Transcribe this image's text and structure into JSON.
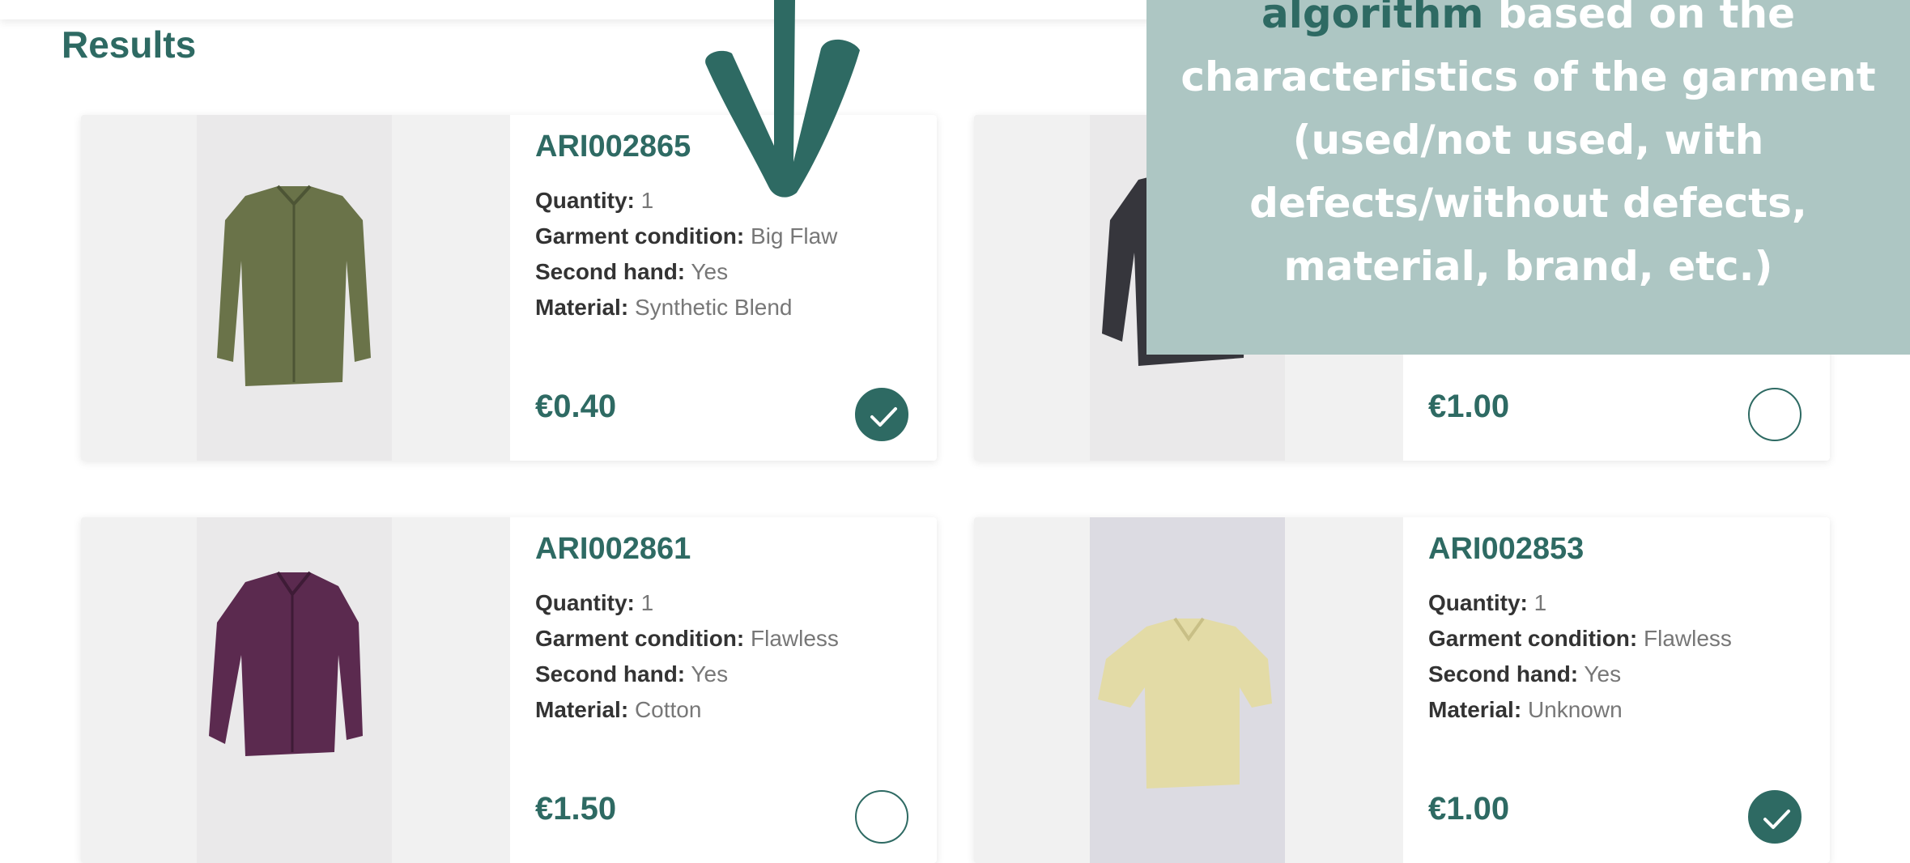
{
  "page": {
    "title": "Results"
  },
  "cards": [
    {
      "code": "ARI002865",
      "quantity_label": "Quantity:",
      "quantity": "1",
      "condition_label": "Garment condition:",
      "condition": "Big Flaw",
      "second_hand_label": "Second hand:",
      "second_hand": "Yes",
      "material_label": "Material:",
      "material": "Synthetic Blend",
      "price": "€0.40",
      "selected": true,
      "garment_color": "#6a7349"
    },
    {
      "code": "",
      "price": "€1.00",
      "selected": false,
      "garment_color": "#36363c"
    },
    {
      "code": "ARI002861",
      "quantity_label": "Quantity:",
      "quantity": "1",
      "condition_label": "Garment condition:",
      "condition": "Flawless",
      "second_hand_label": "Second hand:",
      "second_hand": "Yes",
      "material_label": "Material:",
      "material": "Cotton",
      "price": "€1.50",
      "selected": false,
      "garment_color": "#5b2a4f"
    },
    {
      "code": "ARI002853",
      "quantity_label": "Quantity:",
      "quantity": "1",
      "condition_label": "Garment condition:",
      "condition": "Flawless",
      "second_hand_label": "Second hand:",
      "second_hand": "Yes",
      "material_label": "Material:",
      "material": "Unknown",
      "price": "€1.00",
      "selected": true,
      "garment_color": "#e3dba6"
    }
  ],
  "overlay": {
    "highlight": "algorithm",
    "line1_rest": " based on the",
    "line2": "characteristics of the garment",
    "line3": "(used/not used, with",
    "line4": "defects/without defects,",
    "line5": "material, brand, etc.)"
  },
  "colors": {
    "accent": "#2e6a63",
    "overlay_bg": "#adc6c3"
  },
  "icons": {
    "selected": "check-icon",
    "arrow": "arrow-down-icon"
  }
}
